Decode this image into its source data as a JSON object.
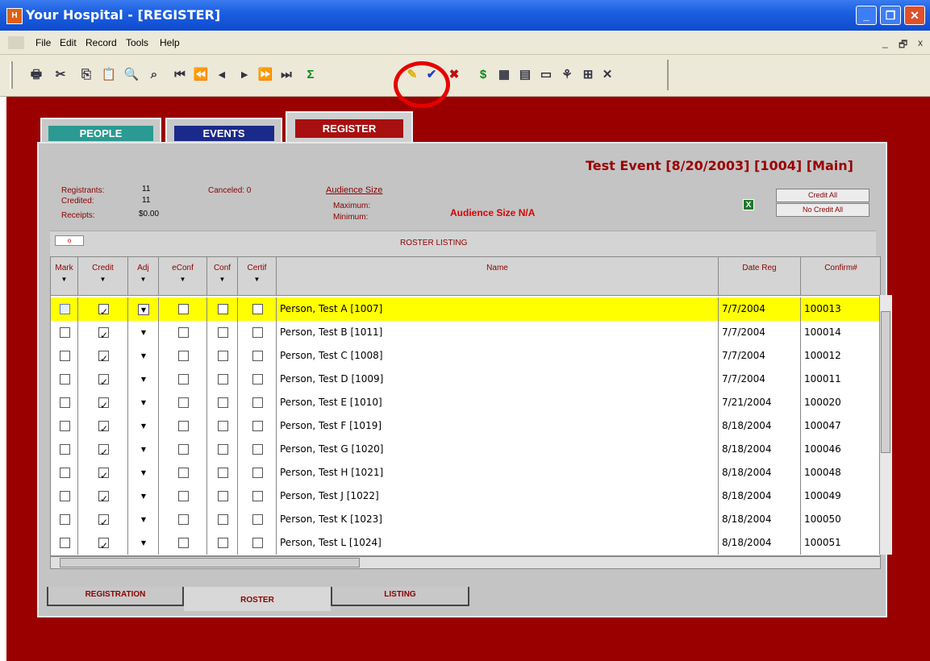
{
  "window": {
    "title": "Your Hospital - [REGISTER]",
    "icon": "app-icon",
    "controls": [
      "minimize",
      "maximize",
      "close"
    ]
  },
  "menu": {
    "items": [
      "File",
      "Edit",
      "Record",
      "Tools",
      "Help"
    ],
    "mdi_controls": [
      "_",
      "🗗",
      "x"
    ]
  },
  "toolbar": {
    "buttons": [
      {
        "name": "print-icon",
        "glyph": "🖶"
      },
      {
        "name": "cut-icon",
        "glyph": "✂"
      },
      {
        "name": "copy-icon",
        "glyph": "⎘"
      },
      {
        "name": "paste-icon",
        "glyph": "📋"
      },
      {
        "name": "find-icon",
        "glyph": "🔍"
      },
      {
        "name": "find-replace-icon",
        "glyph": "⌕"
      },
      {
        "name": "first-record-icon",
        "glyph": "⏮"
      },
      {
        "name": "prev-page-icon",
        "glyph": "⏪"
      },
      {
        "name": "prev-record-icon",
        "glyph": "◂"
      },
      {
        "name": "next-record-icon",
        "glyph": "▸"
      },
      {
        "name": "next-page-icon",
        "glyph": "⏩"
      },
      {
        "name": "last-record-icon",
        "glyph": "⏭"
      },
      {
        "name": "sum-icon",
        "glyph": "Σ"
      },
      {
        "name": "pencil-icon",
        "glyph": "✎"
      },
      {
        "name": "checkmark-icon",
        "glyph": "✔"
      },
      {
        "name": "delete-x-icon",
        "glyph": "✖"
      },
      {
        "name": "dollar-icon",
        "glyph": "$"
      },
      {
        "name": "calendar-icon",
        "glyph": "▦"
      },
      {
        "name": "document-icon",
        "glyph": "▤"
      },
      {
        "name": "card-icon",
        "glyph": "▭"
      },
      {
        "name": "tree-icon",
        "glyph": "⚘"
      },
      {
        "name": "chart-icon",
        "glyph": "⊞"
      },
      {
        "name": "tools-icon",
        "glyph": "✕"
      }
    ]
  },
  "top_tabs": {
    "people": "PEOPLE",
    "events": "EVENTS",
    "register": "REGISTER"
  },
  "event_title": "Test Event [8/20/2003] [1004] [Main]",
  "stats": {
    "registrants_label": "Registrants:",
    "registrants_value": "11",
    "credited_label": "Credited:",
    "credited_value": "11",
    "receipts_label": "Receipts:",
    "receipts_value": "$0.00",
    "canceled_label": "Canceled: 0",
    "audience_size_link": "Audience Size",
    "maximum_label": "Maximum:",
    "minimum_label": "Minimum:",
    "audience_na": "Audience Size N/A"
  },
  "buttons": {
    "credit_all": "Credit All",
    "no_credit_all": "No Credit All"
  },
  "roster": {
    "toggle": "o",
    "title": "ROSTER LISTING",
    "columns": [
      "Mark",
      "Credit",
      "Adj",
      "eConf",
      "Conf",
      "Certif",
      "Name",
      "Date Reg",
      "Confirm#"
    ],
    "rows": [
      {
        "mark": false,
        "credit": true,
        "econf": false,
        "conf": false,
        "certif": false,
        "name": "Person, Test A [1007]",
        "date": "7/7/2004",
        "confirm": "100013",
        "highlight": true
      },
      {
        "mark": false,
        "credit": true,
        "econf": false,
        "conf": false,
        "certif": false,
        "name": "Person, Test B [1011]",
        "date": "7/7/2004",
        "confirm": "100014"
      },
      {
        "mark": false,
        "credit": true,
        "econf": false,
        "conf": false,
        "certif": false,
        "name": "Person, Test C [1008]",
        "date": "7/7/2004",
        "confirm": "100012"
      },
      {
        "mark": false,
        "credit": true,
        "econf": false,
        "conf": false,
        "certif": false,
        "name": "Person, Test D [1009]",
        "date": "7/7/2004",
        "confirm": "100011"
      },
      {
        "mark": false,
        "credit": true,
        "econf": false,
        "conf": false,
        "certif": false,
        "name": "Person, Test E [1010]",
        "date": "7/21/2004",
        "confirm": "100020"
      },
      {
        "mark": false,
        "credit": true,
        "econf": false,
        "conf": false,
        "certif": false,
        "name": "Person, Test F [1019]",
        "date": "8/18/2004",
        "confirm": "100047"
      },
      {
        "mark": false,
        "credit": true,
        "econf": false,
        "conf": false,
        "certif": false,
        "name": "Person, Test G [1020]",
        "date": "8/18/2004",
        "confirm": "100046"
      },
      {
        "mark": false,
        "credit": true,
        "econf": false,
        "conf": false,
        "certif": false,
        "name": "Person, Test H [1021]",
        "date": "8/18/2004",
        "confirm": "100048"
      },
      {
        "mark": false,
        "credit": true,
        "econf": false,
        "conf": false,
        "certif": false,
        "name": "Person, Test J [1022]",
        "date": "8/18/2004",
        "confirm": "100049"
      },
      {
        "mark": false,
        "credit": true,
        "econf": false,
        "conf": false,
        "certif": false,
        "name": "Person, Test K [1023]",
        "date": "8/18/2004",
        "confirm": "100050"
      },
      {
        "mark": false,
        "credit": true,
        "econf": false,
        "conf": false,
        "certif": false,
        "name": "Person, Test L [1024]",
        "date": "8/18/2004",
        "confirm": "100051"
      }
    ]
  },
  "bottom_tabs": {
    "registration": "REGISTRATION",
    "roster": "ROSTER",
    "listing": "LISTING"
  },
  "colors": {
    "workspace": "#9a0000",
    "highlight_row": "#ffff00",
    "callout": "#e60000",
    "label_red": "#8a0000"
  }
}
